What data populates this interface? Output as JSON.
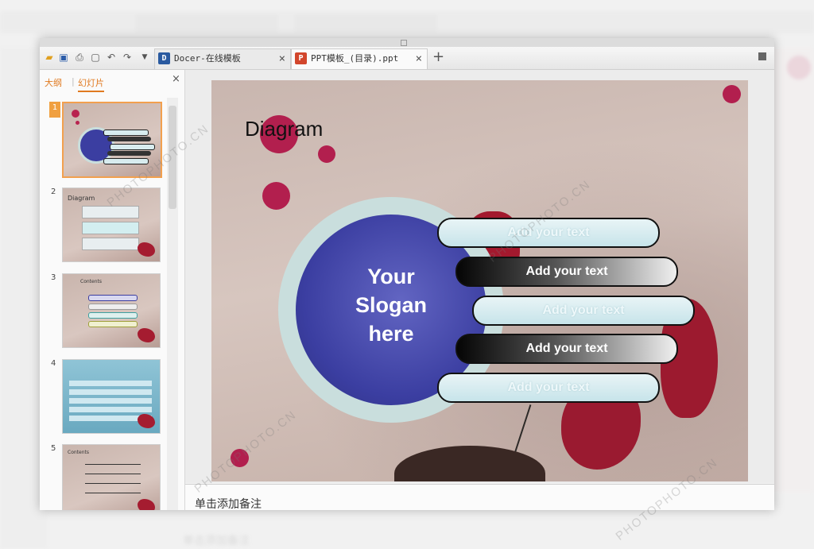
{
  "window": {
    "tabs": [
      {
        "label": "Docer-在线模板",
        "icon": "docer-icon",
        "color": "#2a5aa0"
      },
      {
        "label": "PPT模板_(目录).ppt",
        "icon": "ppt-icon",
        "color": "#d2462c"
      }
    ],
    "new_tab": "+"
  },
  "toolbar": {
    "icons": [
      "folder-open-icon",
      "save-icon",
      "print-icon",
      "print-preview-icon",
      "undo-icon",
      "redo-icon",
      "dropdown-icon"
    ]
  },
  "left_panel": {
    "tabs": [
      "大纲",
      "幻灯片"
    ],
    "active_tab": "幻灯片",
    "close": "×",
    "thumbnails": [
      {
        "number": "1",
        "title": "",
        "selected": true
      },
      {
        "number": "2",
        "title": "Diagram",
        "selected": false
      },
      {
        "number": "3",
        "title": "Contents",
        "selected": false
      },
      {
        "number": "4",
        "title": "",
        "selected": false
      },
      {
        "number": "5",
        "title": "Contents",
        "selected": false
      }
    ]
  },
  "slide": {
    "title": "Diagram",
    "slogan_line1": "Your",
    "slogan_line2": "Slogan",
    "slogan_line3": "here",
    "items": [
      "Add your text",
      "Add your text",
      "Add your text",
      "Add your text",
      "Add your text"
    ]
  },
  "notes": {
    "placeholder": "单击添加备注"
  },
  "watermark": {
    "text": "PHOTOPHOTO.CN"
  },
  "colors": {
    "accent": "#e07a20",
    "dot": "#b21f4e",
    "disk": "#3b3ea1"
  }
}
